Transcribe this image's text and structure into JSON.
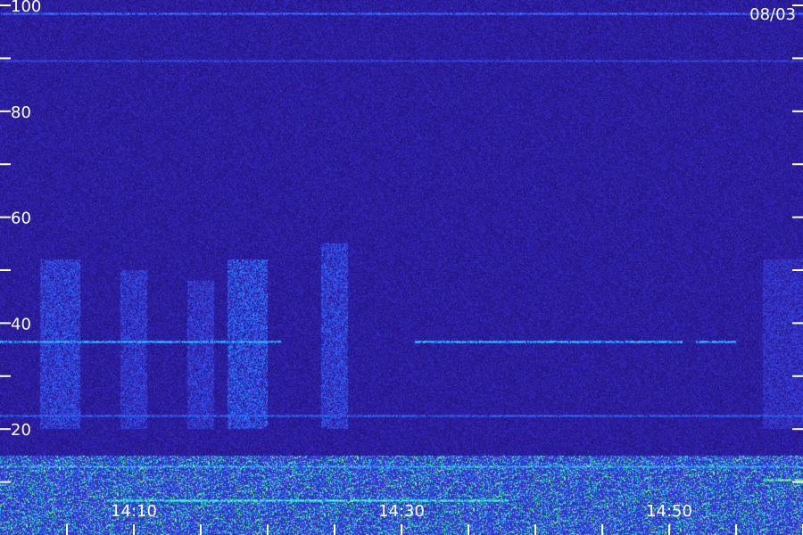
{
  "chart_data": {
    "type": "heatmap",
    "title": "",
    "date_label": "08/03",
    "xlabel": "",
    "ylabel": "",
    "x_range": [
      "14:00",
      "15:00"
    ],
    "y_range": [
      0,
      100
    ],
    "y_tick_labels": [
      {
        "value": 100,
        "label": "100"
      },
      {
        "value": 80,
        "label": "80"
      },
      {
        "value": 60,
        "label": "60"
      },
      {
        "value": 40,
        "label": "40"
      },
      {
        "value": 20,
        "label": "20"
      }
    ],
    "y_minor_ticks": [
      10,
      30,
      50,
      70,
      90
    ],
    "x_tick_labels": [
      {
        "value": "14:10",
        "label": "14:10"
      },
      {
        "value": "14:30",
        "label": "14:30"
      },
      {
        "value": "14:50",
        "label": "14:50"
      }
    ],
    "x_minor_ticks": [
      "14:05",
      "14:15",
      "14:20",
      "14:25",
      "14:35",
      "14:40",
      "14:45",
      "14:55",
      "15:00"
    ],
    "colormap": [
      "#1a0a5a",
      "#2a1a9a",
      "#3a3ad8",
      "#2a6aff",
      "#22c8ff",
      "#34ff9a",
      "#d8ff30"
    ],
    "background_intensity": 0.22,
    "lines": [
      {
        "y": 98.5,
        "from": "14:00",
        "to": "15:00",
        "intensity": 0.6
      },
      {
        "y": 89.5,
        "from": "14:00",
        "to": "15:00",
        "intensity": 0.45
      },
      {
        "y": 36.5,
        "from": "14:00",
        "to": "14:21",
        "intensity": 0.85
      },
      {
        "y": 36.5,
        "from": "14:31",
        "to": "14:51",
        "intensity": 0.85
      },
      {
        "y": 36.5,
        "from": "14:52",
        "to": "14:55",
        "intensity": 0.85
      },
      {
        "y": 22.5,
        "from": "14:00",
        "to": "15:00",
        "intensity": 0.55
      },
      {
        "y": 13,
        "from": "14:00",
        "to": "15:00",
        "intensity": 0.75
      },
      {
        "y": 6.5,
        "from": "14:08",
        "to": "14:38",
        "intensity": 1.0
      },
      {
        "y": 10.5,
        "from": "14:57",
        "to": "15:00",
        "intensity": 1.0
      }
    ],
    "bursts": [
      {
        "from": "14:03",
        "to": "14:06",
        "y_from": 20,
        "y_to": 52,
        "intensity": 0.45
      },
      {
        "from": "14:09",
        "to": "14:11",
        "y_from": 20,
        "y_to": 50,
        "intensity": 0.4
      },
      {
        "from": "14:14",
        "to": "14:16",
        "y_from": 20,
        "y_to": 48,
        "intensity": 0.4
      },
      {
        "from": "14:17",
        "to": "14:20",
        "y_from": 20,
        "y_to": 52,
        "intensity": 0.5
      },
      {
        "from": "14:24",
        "to": "14:26",
        "y_from": 20,
        "y_to": 55,
        "intensity": 0.45
      },
      {
        "from": "14:57",
        "to": "15:00",
        "y_from": 20,
        "y_to": 52,
        "intensity": 0.35
      }
    ],
    "grid": false,
    "legend": "none"
  }
}
